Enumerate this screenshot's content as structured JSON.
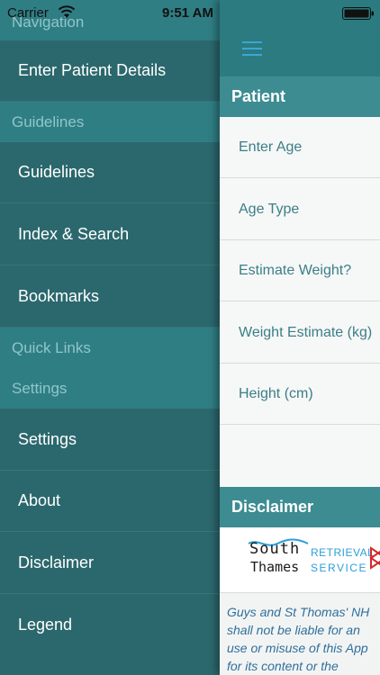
{
  "status_bar": {
    "carrier": "Carrier",
    "time": "9:51 AM"
  },
  "sidebar": {
    "sections": [
      {
        "header": "Navigation",
        "items": [
          "Enter Patient Details"
        ]
      },
      {
        "header": "Guidelines",
        "items": [
          "Guidelines",
          "Index & Search",
          "Bookmarks"
        ]
      },
      {
        "header": "Quick Links",
        "items": []
      },
      {
        "header": "Settings",
        "items": [
          "Settings",
          "About",
          "Disclaimer",
          "Legend"
        ]
      }
    ]
  },
  "main": {
    "patient_section": {
      "title": "Patient",
      "fields": [
        "Enter Age",
        "Age Type",
        "Estimate Weight?",
        "Weight Estimate (kg)",
        "Height (cm)"
      ]
    },
    "disclaimer_section": {
      "title": "Disclaimer",
      "logo": {
        "line1": "South",
        "line2": "Thames",
        "retrieval": "RETRIEVAL",
        "service": "SERVICE"
      },
      "text_lines": [
        "Guys and St Thomas' NH",
        "shall not be liable for an",
        "use or misuse of this App",
        "for its content or the"
      ]
    }
  },
  "colors": {
    "sidebar_bg": "#2b686d",
    "section_header_bg": "#2f7e84",
    "topbar_bg": "#2b7b80",
    "main_section_header_bg": "#3d8c92",
    "field_text": "#3b7f86",
    "disclaimer_text": "#2f6f9a",
    "logo_blue": "#2a9fd8"
  },
  "icons": {
    "menu": "hamburger-menu-icon",
    "wifi": "wifi-icon",
    "battery": "battery-icon",
    "logo_mark": "red-triangle-mark-icon"
  }
}
